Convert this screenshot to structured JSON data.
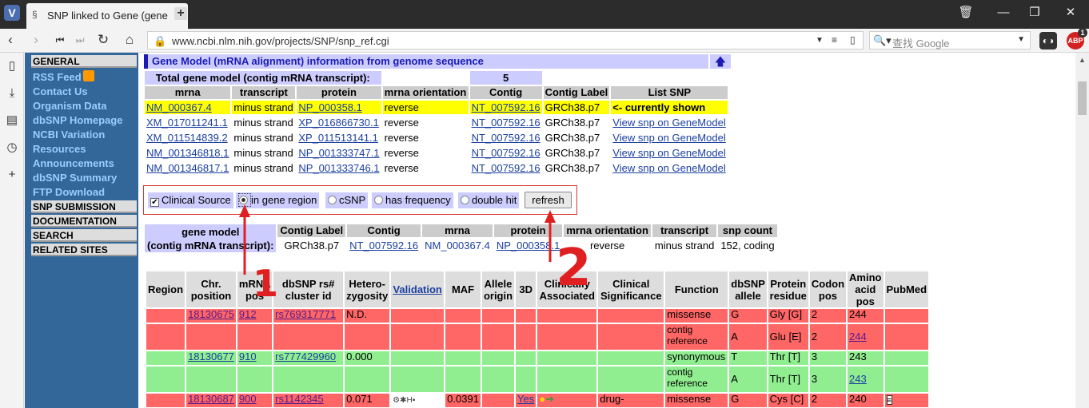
{
  "browser": {
    "logo": "V",
    "tab_title": "SNP linked to Gene (gene",
    "new_tab": "+",
    "url": "www.ncbi.nlm.nih.gov/projects/SNP/snp_ref.cgi",
    "search_placeholder": "查找 Google",
    "adblock_label": "ABP",
    "adblock_badge": "1"
  },
  "left_nav": {
    "general": "GENERAL",
    "links": [
      "RSS Feed",
      "Contact Us",
      "Organism Data",
      "dbSNP Homepage",
      "NCBI Variation",
      "Resources",
      "Announcements",
      "dbSNP Summary",
      "FTP Download"
    ],
    "sections": [
      "SNP SUBMISSION",
      "DOCUMENTATION",
      "SEARCH",
      "RELATED SITES"
    ]
  },
  "gene_model": {
    "header": "Gene Model (mRNA alignment) information from genome sequence",
    "total_label": "Total gene model (contig mRNA transcript):",
    "total_value": "5",
    "columns": [
      "mrna",
      "transcript",
      "protein",
      "mrna orientation",
      "Contig",
      "Contig Label",
      "List SNP"
    ],
    "rows": [
      {
        "mrna": "NM_000367.4",
        "transcript": "minus strand",
        "protein": "NP_000358.1",
        "orientation": "reverse",
        "contig": "NT_007592.16",
        "label": "GRCh38.p7",
        "list": "<- currently shown"
      },
      {
        "mrna": "XM_017011241.1",
        "transcript": "minus strand",
        "protein": "XP_016866730.1",
        "orientation": "reverse",
        "contig": "NT_007592.16",
        "label": "GRCh38.p7",
        "list": "View snp on GeneModel"
      },
      {
        "mrna": "XM_011514839.2",
        "transcript": "minus strand",
        "protein": "XP_011513141.1",
        "orientation": "reverse",
        "contig": "NT_007592.16",
        "label": "GRCh38.p7",
        "list": "View snp on GeneModel"
      },
      {
        "mrna": "NM_001346818.1",
        "transcript": "minus strand",
        "protein": "NP_001333747.1",
        "orientation": "reverse",
        "contig": "NT_007592.16",
        "label": "GRCh38.p7",
        "list": "View snp on GeneModel"
      },
      {
        "mrna": "NM_001346817.1",
        "transcript": "minus strand",
        "protein": "NP_001333746.1",
        "orientation": "reverse",
        "contig": "NT_007592.16",
        "label": "GRCh38.p7",
        "list": "View snp on GeneModel"
      }
    ]
  },
  "filters": {
    "clinical_source": "Clinical Source",
    "in_gene_region": "in gene region",
    "csnp": "cSNP",
    "has_frequency": "has frequency",
    "double_hit": "double hit",
    "refresh": "refresh",
    "selected": "in gene region"
  },
  "summary": {
    "label_line1": "gene model",
    "label_line2": "(contig mRNA transcript):",
    "columns": [
      "Contig Label",
      "Contig",
      "mrna",
      "protein",
      "mrna orientation",
      "transcript",
      "snp count"
    ],
    "values": [
      "GRCh38.p7",
      "NT_007592.16",
      "NM_000367.4",
      "NP_000358.1",
      "reverse",
      "minus strand",
      "152, coding"
    ]
  },
  "snp_table": {
    "columns": [
      "Region",
      "Chr. position",
      "mRNA pos",
      "dbSNP rs# cluster id",
      "Hetero-zygosity",
      "Validation",
      "MAF",
      "Allele origin",
      "3D",
      "Clinically Associated",
      "Clinical Significance",
      "Function",
      "dbSNP allele",
      "Protein residue",
      "Codon pos",
      "Amino acid pos",
      "PubMed"
    ],
    "rows": [
      {
        "color": "red",
        "chr": "18130675",
        "mrna": "912",
        "rs": "rs769317771",
        "het": "N.D.",
        "maf": "",
        "threed": "",
        "clin_sig": "",
        "function": "missense",
        "allele": "G",
        "residue": "Gly [G]",
        "codon": "2",
        "aa": "244",
        "aa_link": false
      },
      {
        "color": "red",
        "chr": "",
        "mrna": "",
        "rs": "",
        "het": "",
        "maf": "",
        "threed": "",
        "clin_sig": "",
        "function": "contig reference",
        "allele": "A",
        "residue": "Glu [E]",
        "codon": "2",
        "aa": "244",
        "aa_link": true
      },
      {
        "color": "green",
        "chr": "18130677",
        "mrna": "910",
        "rs": "rs777429960",
        "het": "0.000",
        "maf": "",
        "threed": "",
        "clin_sig": "",
        "function": "synonymous",
        "allele": "T",
        "residue": "Thr [T]",
        "codon": "3",
        "aa": "243",
        "aa_link": false
      },
      {
        "color": "green",
        "chr": "",
        "mrna": "",
        "rs": "",
        "het": "",
        "maf": "",
        "threed": "",
        "clin_sig": "",
        "function": "contig reference",
        "allele": "A",
        "residue": "Thr [T]",
        "codon": "3",
        "aa": "243",
        "aa_link": true
      },
      {
        "color": "red",
        "chr": "18130687",
        "mrna": "900",
        "rs": "rs1142345",
        "het": "0.071",
        "maf": "0.0391",
        "threed": "Yes",
        "clin_sig": "drug-",
        "function": "missense",
        "allele": "G",
        "residue": "Cys [C]",
        "codon": "2",
        "aa": "240",
        "aa_link": false
      }
    ]
  },
  "annotations": {
    "one": "1",
    "two": "2",
    "color": "#e02020"
  }
}
